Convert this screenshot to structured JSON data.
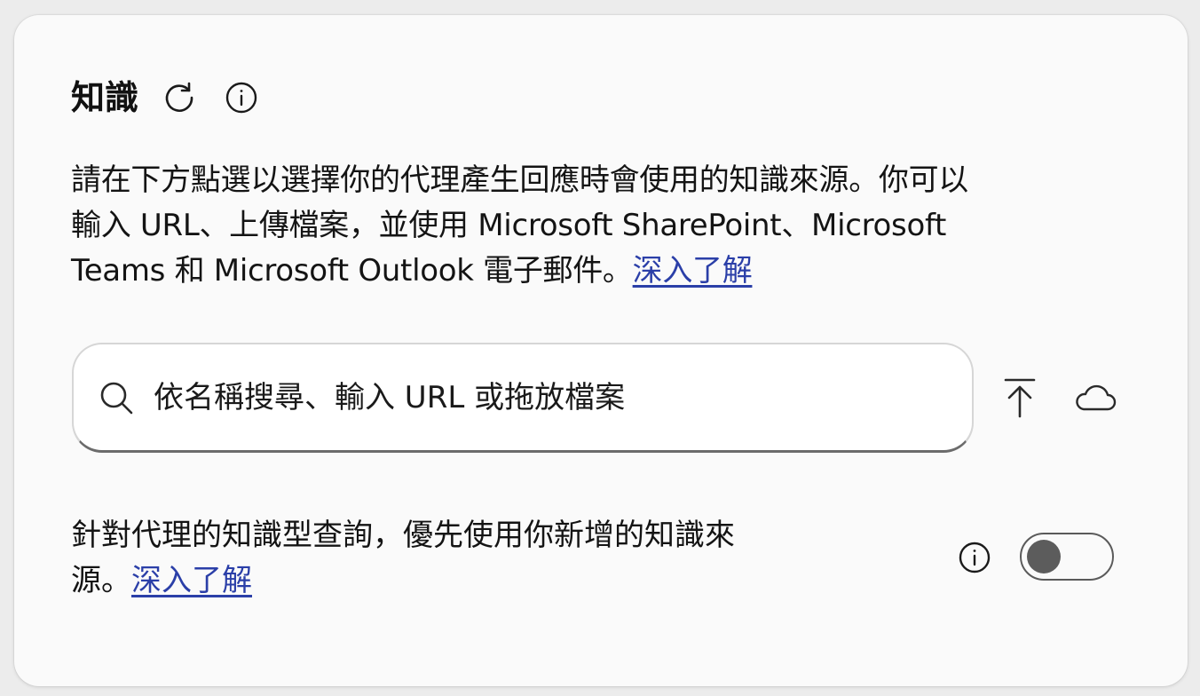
{
  "knowledge": {
    "title": "知識",
    "description_lines": [
      "請在下方點選以選擇你的代理產生回應時會使用的知識來源。你可以",
      "輸入 URL、上傳檔案，並使用 Microsoft SharePoint、Microsoft",
      "Teams 和 Microsoft Outlook 電子郵件。"
    ],
    "learn_more": "深入了解",
    "search": {
      "placeholder": "依名稱搜尋、輸入 URL 或拖放檔案",
      "value": ""
    },
    "preference": {
      "line1": "針對代理的知識型查詢，優先使用你新增的知識來",
      "line2": "源。",
      "learn_more": "深入了解",
      "toggle_on": false
    },
    "icons": {
      "refresh": "refresh-icon",
      "info": "info-icon",
      "search": "search-icon",
      "upload": "upload-icon",
      "cloud": "cloud-icon"
    },
    "colors": {
      "link": "#2b3fa8",
      "toggle_knob": "#5c5c5c"
    }
  }
}
